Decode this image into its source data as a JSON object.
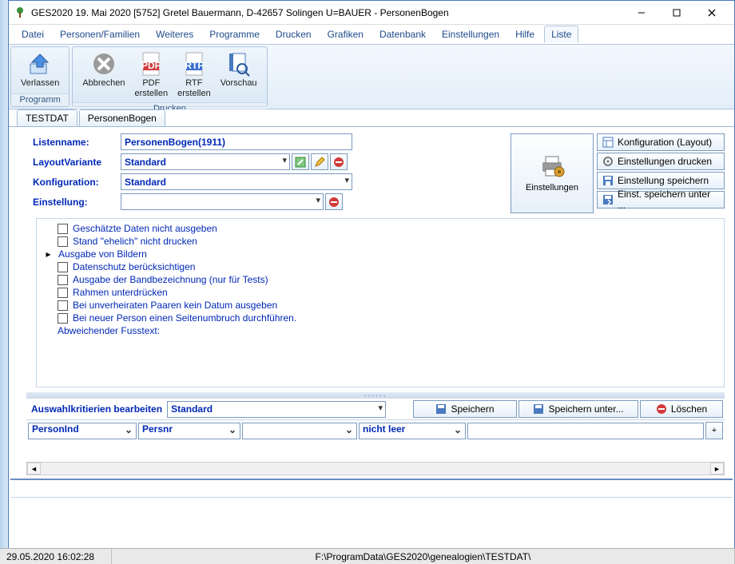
{
  "window": {
    "title": "GES2020 19. Mai 2020  [5752] Gretel Bauermann, D-42657 Solingen             U=BAUER  - PersonenBogen"
  },
  "menu": [
    "Datei",
    "Personen/Familien",
    "Weiteres",
    "Programme",
    "Drucken",
    "Grafiken",
    "Datenbank",
    "Einstellungen",
    "Hilfe",
    "Liste"
  ],
  "ribbon": {
    "group1": {
      "caption": "Programm",
      "btn1": "Verlassen"
    },
    "group2": {
      "caption": "Drucken",
      "btn1": "Abbrechen",
      "btn2": "PDF\nerstellen",
      "btn3": "RTF\nerstellen",
      "btn4": "Vorschau"
    }
  },
  "tabs": [
    "TESTDAT",
    "PersonenBogen"
  ],
  "form": {
    "listenname_label": "Listenname:",
    "listenname_value": "PersonenBogen(1911)",
    "layout_label": "LayoutVariante",
    "layout_value": "Standard",
    "konfig_label": "Konfiguration:",
    "konfig_value": "Standard",
    "einstellung_label": "Einstellung:",
    "einstellung_value": ""
  },
  "right_panel": {
    "big": "Einstellungen",
    "btn1": "Konfiguration (Layout)",
    "btn2": "Einstellungen drucken",
    "btn3": "Einstellung speichern",
    "btn4": "Einst. speichern unter ..."
  },
  "options": [
    {
      "cb": true,
      "label": "Geschätzte Daten nicht ausgeben"
    },
    {
      "cb": true,
      "label": "Stand \"ehelich\" nicht drucken"
    },
    {
      "arrow": true,
      "label": "Ausgabe von Bildern"
    },
    {
      "cb": true,
      "label": "Datenschutz berücksichtigen"
    },
    {
      "cb": true,
      "label": "Ausgabe der Bandbezeichnung (nur für Tests)"
    },
    {
      "cb": true,
      "label": "Rahmen unterdrücken"
    },
    {
      "cb": true,
      "label": "Bei unverheiraten Paaren kein Datum ausgeben"
    },
    {
      "cb": true,
      "label": "Bei neuer Person einen Seitenumbruch durchführen."
    },
    {
      "plain": true,
      "label": "Abweichender Fusstext:"
    }
  ],
  "criteria": {
    "title": "Auswahlkritierien bearbeiten",
    "combo": "Standard",
    "save": "Speichern",
    "saveas": "Speichern unter...",
    "delete": "Löschen",
    "col1": "PersonInd",
    "col2": "Persnr",
    "col3": "",
    "col4": "nicht leer",
    "plus": "+"
  },
  "status": {
    "left": "29.05.2020 16:02:28",
    "center": "F:\\ProgramData\\GES2020\\genealogien\\TESTDAT\\"
  }
}
